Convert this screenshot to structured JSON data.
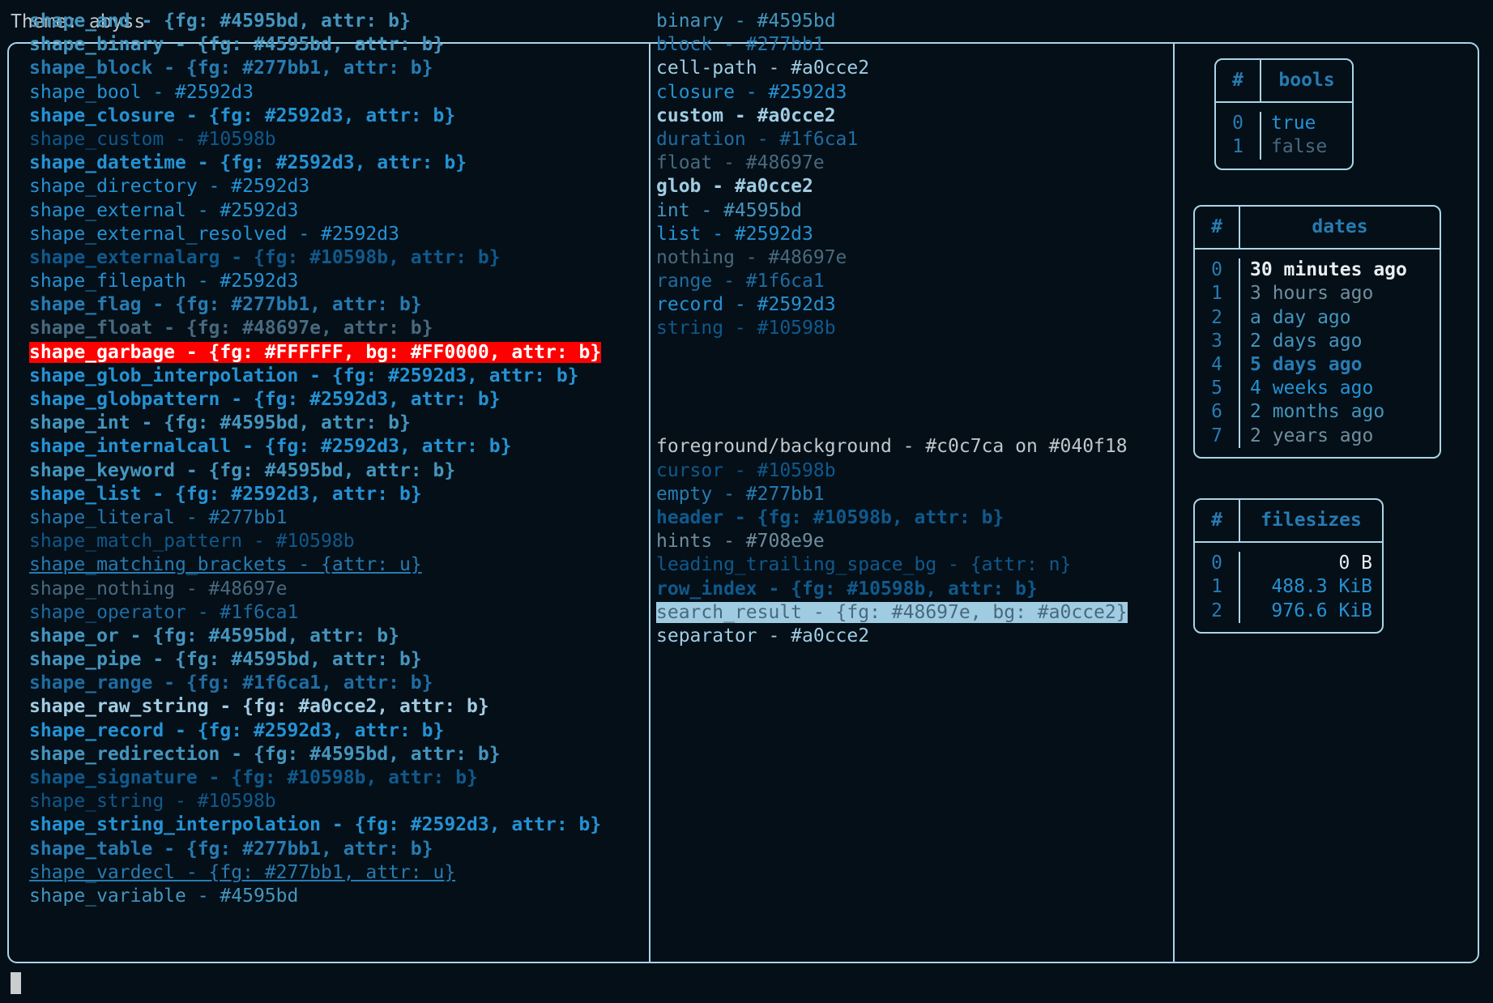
{
  "theme": {
    "label": "Theme: abyss"
  },
  "palette": {
    "background": "#040f18",
    "foreground": "#c0c7ca",
    "border": "#a9d5e8",
    "accent_blue": "#2592d3",
    "accent_blue2": "#4595bd",
    "accent_blue3": "#277bb1",
    "dim": "#10598b",
    "gray": "#48697e",
    "cyan": "#1f6ca1",
    "light": "#a0cce2",
    "hints": "#708e9e",
    "garbage_fg": "#FFFFFF",
    "garbage_bg": "#FF0000",
    "search_result_fg": "#48697e",
    "search_result_bg": "#a0cce2"
  },
  "shapes_column": [
    {
      "text": "shape_and - {fg: #4595bd, attr: b}",
      "style": "c-blue2 bold"
    },
    {
      "text": "shape_binary - {fg: #4595bd, attr: b}",
      "style": "c-blue2 bold"
    },
    {
      "text": "shape_block - {fg: #277bb1, attr: b}",
      "style": "c-blue3 bold"
    },
    {
      "text": "shape_bool - #2592d3",
      "style": "c-blue"
    },
    {
      "text": "shape_closure - {fg: #2592d3, attr: b}",
      "style": "c-blue bold"
    },
    {
      "text": "shape_custom - #10598b",
      "style": "c-dim"
    },
    {
      "text": "shape_datetime - {fg: #2592d3, attr: b}",
      "style": "c-blue bold"
    },
    {
      "text": "shape_directory - #2592d3",
      "style": "c-blue"
    },
    {
      "text": "shape_external - #2592d3",
      "style": "c-blue"
    },
    {
      "text": "shape_external_resolved - #2592d3",
      "style": "c-blue"
    },
    {
      "text": "shape_externalarg - {fg: #10598b, attr: b}",
      "style": "c-dim bold"
    },
    {
      "text": "shape_filepath - #2592d3",
      "style": "c-blue"
    },
    {
      "text": "shape_flag - {fg: #277bb1, attr: b}",
      "style": "c-blue3 bold"
    },
    {
      "text": "shape_float - {fg: #48697e, attr: b}",
      "style": "c-gray bold"
    },
    {
      "text": "shape_garbage - {fg: #FFFFFF, bg: #FF0000, attr: b}",
      "style": "hl-red"
    },
    {
      "text": "shape_glob_interpolation - {fg: #2592d3, attr: b}",
      "style": "c-blue bold"
    },
    {
      "text": "shape_globpattern - {fg: #2592d3, attr: b}",
      "style": "c-blue bold"
    },
    {
      "text": "shape_int - {fg: #4595bd, attr: b}",
      "style": "c-blue2 bold"
    },
    {
      "text": "shape_internalcall - {fg: #2592d3, attr: b}",
      "style": "c-blue bold"
    },
    {
      "text": "shape_keyword - {fg: #4595bd, attr: b}",
      "style": "c-blue2 bold"
    },
    {
      "text": "shape_list - {fg: #2592d3, attr: b}",
      "style": "c-blue bold"
    },
    {
      "text": "shape_literal - #277bb1",
      "style": "c-blue3"
    },
    {
      "text": "shape_match_pattern - #10598b",
      "style": "c-dim"
    },
    {
      "text": "shape_matching_brackets - {attr: u}",
      "style": "c-blue3 ul"
    },
    {
      "text": "shape_nothing - #48697e",
      "style": "c-gray"
    },
    {
      "text": "shape_operator - #1f6ca1",
      "style": "c-cyan"
    },
    {
      "text": "shape_or - {fg: #4595bd, attr: b}",
      "style": "c-blue2 bold"
    },
    {
      "text": "shape_pipe - {fg: #4595bd, attr: b}",
      "style": "c-blue2 bold"
    },
    {
      "text": "shape_range - {fg: #1f6ca1, attr: b}",
      "style": "c-cyan bold"
    },
    {
      "text": "shape_raw_string - {fg: #a0cce2, attr: b}",
      "style": "c-light bold"
    },
    {
      "text": "shape_record - {fg: #2592d3, attr: b}",
      "style": "c-blue bold"
    },
    {
      "text": "shape_redirection - {fg: #4595bd, attr: b}",
      "style": "c-blue2 bold"
    },
    {
      "text": "shape_signature - {fg: #10598b, attr: b}",
      "style": "c-dim bold"
    },
    {
      "text": "shape_string - #10598b",
      "style": "c-dim"
    },
    {
      "text": "shape_string_interpolation - {fg: #2592d3, attr: b}",
      "style": "c-blue bold"
    },
    {
      "text": "shape_table - {fg: #277bb1, attr: b}",
      "style": "c-blue3 bold"
    },
    {
      "text": "shape_vardecl - {fg: #277bb1, attr: u}",
      "style": "c-blue3 ul"
    },
    {
      "text": "shape_variable - #4595bd",
      "style": "c-blue2"
    }
  ],
  "types_column": [
    {
      "text": "binary - #4595bd",
      "style": "c-blue2"
    },
    {
      "text": "block - #277bb1",
      "style": "c-blue3"
    },
    {
      "text": "cell-path - #a0cce2",
      "style": "c-light"
    },
    {
      "text": "closure - #2592d3",
      "style": "c-blue"
    },
    {
      "text": "custom - #a0cce2",
      "style": "c-light bold"
    },
    {
      "text": "duration - #1f6ca1",
      "style": "c-cyan"
    },
    {
      "text": "float - #48697e",
      "style": "c-gray"
    },
    {
      "text": "glob - #a0cce2",
      "style": "c-light bold"
    },
    {
      "text": "int - #4595bd",
      "style": "c-blue2"
    },
    {
      "text": "list - #2592d3",
      "style": "c-blue"
    },
    {
      "text": "nothing - #48697e",
      "style": "c-gray"
    },
    {
      "text": "range - #1f6ca1",
      "style": "c-cyan"
    },
    {
      "text": "record - #2592d3",
      "style": "c-blue"
    },
    {
      "text": "string - #10598b",
      "style": "c-dim"
    },
    {
      "text": "",
      "style": ""
    },
    {
      "text": "",
      "style": ""
    },
    {
      "text": "",
      "style": ""
    },
    {
      "text": "",
      "style": ""
    },
    {
      "text": "foreground/background - #c0c7ca on #040f18",
      "style": "c-fg"
    },
    {
      "text": "cursor - #10598b",
      "style": "c-dim"
    },
    {
      "text": "empty - #277bb1",
      "style": "c-blue3"
    },
    {
      "text": "header - {fg: #10598b, attr: b}",
      "style": "c-dim bold"
    },
    {
      "text": "hints - #708e9e",
      "style": "c-hint"
    },
    {
      "text": "leading_trailing_space_bg - {attr: n}",
      "style": "c-dim"
    },
    {
      "text": "row_index - {fg: #10598b, attr: b}",
      "style": "c-dim bold"
    },
    {
      "text": "search_result - {fg: #48697e, bg: #a0cce2}",
      "style": "hl-search"
    },
    {
      "text": "separator - #a0cce2",
      "style": "c-light"
    }
  ],
  "tables": {
    "bools": {
      "headers": [
        "#",
        "bools"
      ],
      "rows": [
        {
          "index": "0",
          "value": "true",
          "style": "c-blue"
        },
        {
          "index": "1",
          "value": "false",
          "style": "c-gray"
        }
      ]
    },
    "dates": {
      "headers": [
        "#",
        "dates"
      ],
      "rows": [
        {
          "index": "0",
          "value": "30 minutes ago",
          "style": "c-white bold"
        },
        {
          "index": "1",
          "value": "3 hours ago",
          "style": "c-hint"
        },
        {
          "index": "2",
          "value": "a day ago",
          "style": "c-blue2"
        },
        {
          "index": "3",
          "value": "2 days ago",
          "style": "c-blue2"
        },
        {
          "index": "4",
          "value": "5 days ago",
          "style": "c-blue3 bold"
        },
        {
          "index": "5",
          "value": "4 weeks ago",
          "style": "c-blue"
        },
        {
          "index": "6",
          "value": "2 months ago",
          "style": "c-blue2"
        },
        {
          "index": "7",
          "value": "2 years ago",
          "style": "c-hint"
        }
      ]
    },
    "filesizes": {
      "headers": [
        "#",
        "filesizes"
      ],
      "rows": [
        {
          "index": "0",
          "value": "0 B",
          "style": "c-white"
        },
        {
          "index": "1",
          "value": "488.3 KiB",
          "style": "c-blue"
        },
        {
          "index": "2",
          "value": "976.6 KiB",
          "style": "c-blue"
        }
      ]
    }
  }
}
